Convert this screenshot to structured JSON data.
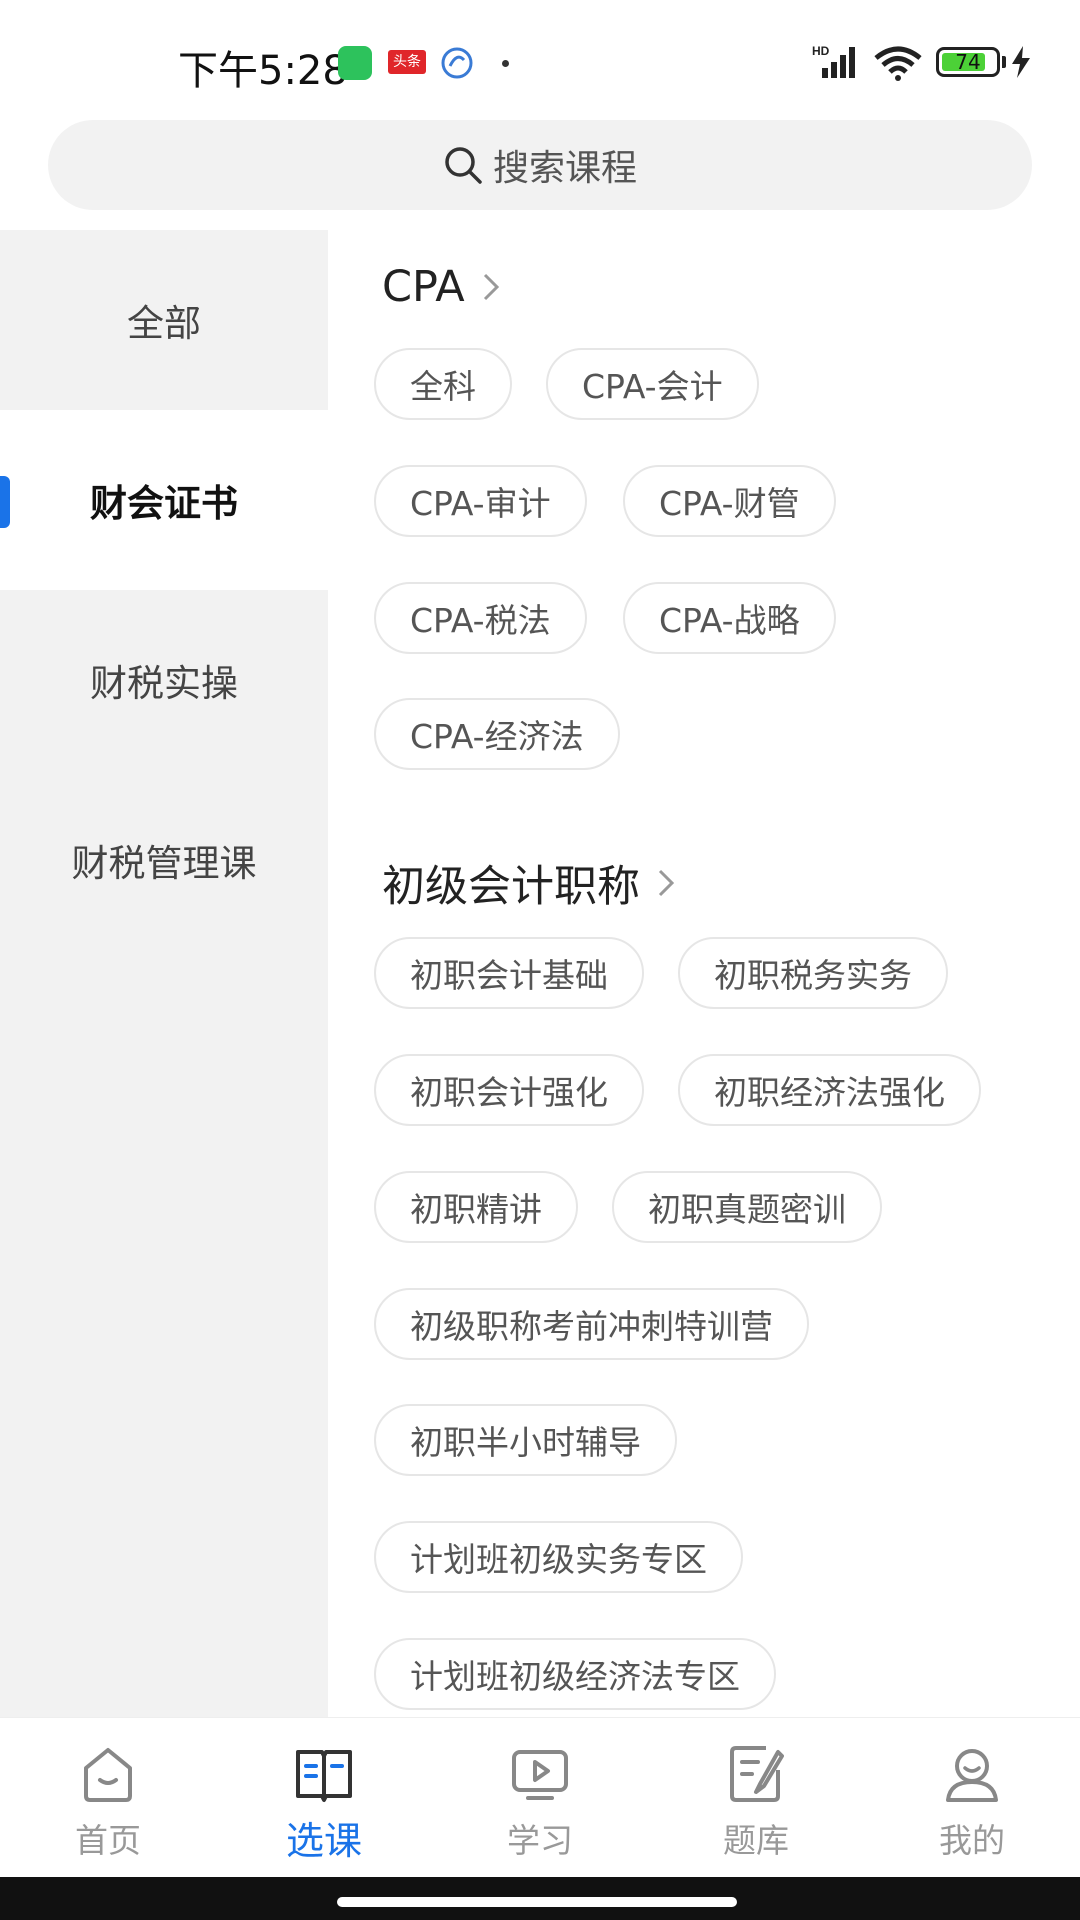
{
  "status_bar": {
    "time": "下午5:28",
    "toutiao_label": "头条",
    "battery_level": "74",
    "network": "HD"
  },
  "search": {
    "placeholder": "搜索课程"
  },
  "sidebar": {
    "items": [
      {
        "label": "全部"
      },
      {
        "label": "财会证书"
      },
      {
        "label": "财税实操"
      },
      {
        "label": "财税管理课"
      }
    ]
  },
  "sections": [
    {
      "title": "CPA",
      "tags": [
        "全科",
        "CPA-会计",
        "CPA-审计",
        "CPA-财管",
        "CPA-税法",
        "CPA-战略",
        "CPA-经济法"
      ]
    },
    {
      "title": "初级会计职称",
      "tags": [
        "初职会计基础",
        "初职税务实务",
        "初职会计强化",
        "初职经济法强化",
        "初职精讲",
        "初职真题密训",
        "初级职称考前冲刺特训营",
        "初职半小时辅导",
        "计划班初级实务专区",
        "计划班初级经济法专区"
      ]
    }
  ],
  "bottom_nav": {
    "items": [
      {
        "label": "首页",
        "icon": "home-icon"
      },
      {
        "label": "选课",
        "icon": "book-icon"
      },
      {
        "label": "学习",
        "icon": "video-icon"
      },
      {
        "label": "题库",
        "icon": "document-edit-icon"
      },
      {
        "label": "我的",
        "icon": "profile-icon"
      }
    ]
  },
  "colors": {
    "accent": "#1a73e8",
    "sidebar_bg": "#f2f2f2",
    "tag_border": "#e6e6e6"
  }
}
